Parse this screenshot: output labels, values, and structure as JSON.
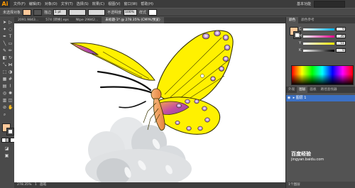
{
  "app": {
    "logo": "Ai",
    "workspace": "基本功能"
  },
  "menu": [
    "文件(F)",
    "编辑(E)",
    "对象(O)",
    "文字(T)",
    "选择(S)",
    "效果(C)",
    "视图(V)",
    "窗口(W)",
    "帮助(H)"
  ],
  "control_bar": {
    "mode": "未选择对象",
    "stroke_label": "描边",
    "stroke_value": "1 pt",
    "opacity_label": "不透明度",
    "opacity_value": "100%",
    "style_label": "样式"
  },
  "doc_tabs": [
    "2091.9843...",
    "574 [转换].eps",
    "Ntpe 29842...",
    "未标题-1* @ 278.35% (CMYK/预览)"
  ],
  "status": {
    "zoom": "278.35%",
    "page": "1",
    "mode": "画笔"
  },
  "color_panel": {
    "tabs": [
      "颜色",
      "颜色参考"
    ],
    "sliders": [
      {
        "label": "C",
        "value": "0",
        "fill": 0,
        "gradient": [
          "#ffffff",
          "#00aeef"
        ]
      },
      {
        "label": "M",
        "value": "30",
        "fill": 0.3,
        "gradient": [
          "#ffffff",
          "#ec008c"
        ]
      },
      {
        "label": "Y",
        "value": "51",
        "fill": 0.51,
        "gradient": [
          "#ffffff",
          "#fff200"
        ]
      },
      {
        "label": "K",
        "value": "0",
        "fill": 0,
        "gradient": [
          "#ffffff",
          "#000000"
        ]
      }
    ],
    "current_fill": "#fdc89a"
  },
  "layers_panel": {
    "tabs": [
      "外观",
      "图层",
      "画板",
      "路径查找器"
    ],
    "layer_name": "图层 1",
    "footer": "1个图层"
  },
  "watermark": {
    "line1": "百度经验",
    "line2": "jingyan.baidu.com"
  },
  "colors": {
    "wing_yellow": "#fff100",
    "wing_outline": "#3a3400",
    "spot_purple": "#7b3f9a",
    "cloud": "#d5d8db",
    "body_orange": "#f3a15a"
  }
}
